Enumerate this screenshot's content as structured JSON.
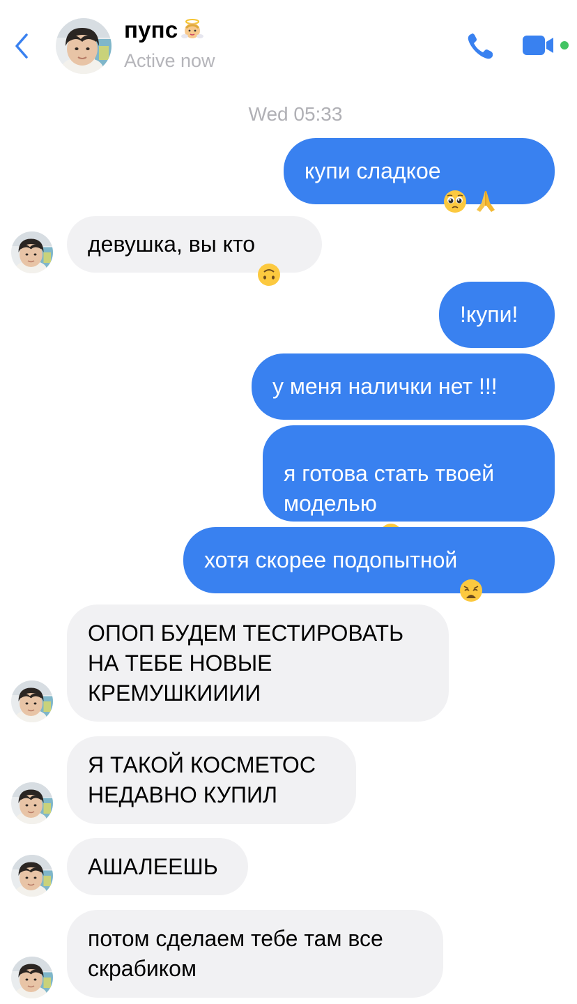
{
  "header": {
    "contact_name": "пупс",
    "status": "Active now",
    "name_emoji": "baby-angel-emoji-icon"
  },
  "conversation": {
    "timestamp": "Wed 05:33",
    "messages": [
      {
        "direction": "outgoing",
        "text": "купи сладкое",
        "emoji": [
          "pleading-face-emoji",
          "folded-hands-emoji"
        ]
      },
      {
        "direction": "incoming",
        "text": "девушка, вы кто",
        "emoji": [
          "upside-down-face-emoji"
        ]
      },
      {
        "direction": "outgoing",
        "text": "!купи!"
      },
      {
        "direction": "outgoing",
        "text": "у меня налички нет !!!"
      },
      {
        "direction": "outgoing",
        "text": "я готова стать твоей\nмоделью",
        "emoji": [
          "sneezing-face-emoji"
        ]
      },
      {
        "direction": "outgoing",
        "text": "хотя скорее подопытной",
        "emoji": [
          "weary-face-emoji"
        ]
      },
      {
        "direction": "incoming",
        "text": "ОПОП БУДЕМ ТЕСТИРОВАТЬ\nНА ТЕБЕ НОВЫЕ\nКРЕМУШКИИИИ"
      },
      {
        "direction": "incoming",
        "text": "Я ТАКОЙ КОСМЕТОС\nНЕДАВНО КУПИЛ"
      },
      {
        "direction": "incoming",
        "text": "АШАЛЕЕШЬ"
      },
      {
        "direction": "incoming",
        "text": "потом сделаем тебе там все\nскрабиком"
      }
    ]
  },
  "colors": {
    "outgoing_bubble": "#3981f0",
    "incoming_bubble": "#f1f1f3",
    "accent": "#3981f0",
    "online": "#43c463",
    "muted_text": "#b0b0b5"
  }
}
